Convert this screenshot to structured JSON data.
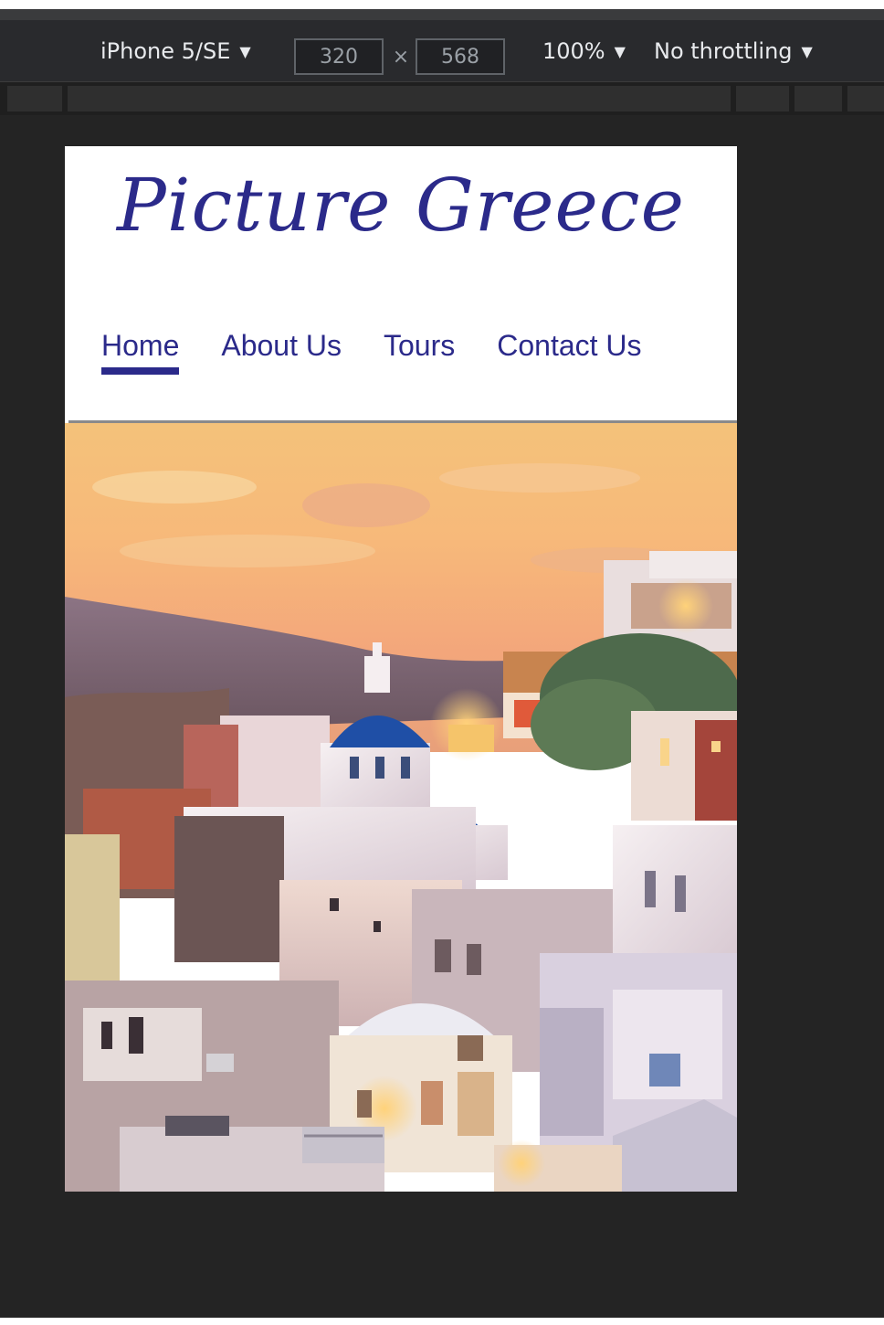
{
  "devtools": {
    "device": "iPhone 5/SE",
    "width_value": "320",
    "times_symbol": "×",
    "height_value": "568",
    "zoom": "100%",
    "throttling": "No throttling"
  },
  "site": {
    "title": "Picture Greece",
    "nav": [
      {
        "label": "Home",
        "active": true
      },
      {
        "label": "About Us",
        "active": false
      },
      {
        "label": "Tours",
        "active": false
      },
      {
        "label": "Contact Us",
        "active": false
      }
    ]
  },
  "colors": {
    "brand": "#2b2a8a",
    "devtools_bg": "#242424",
    "toolbar_bg": "#292a2d"
  }
}
